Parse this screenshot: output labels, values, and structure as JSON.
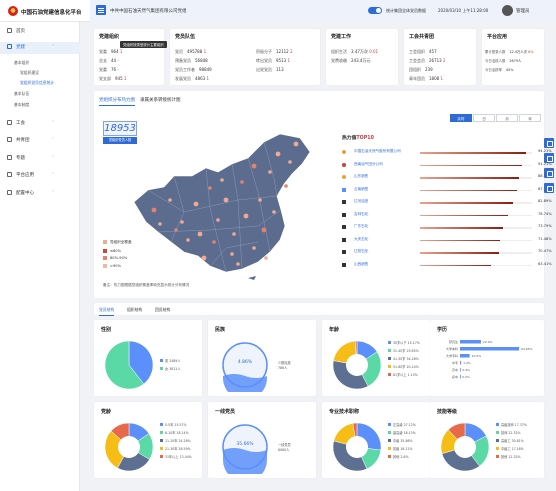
{
  "app": {
    "title": "中国石油党建信息化平台",
    "org": "中共中国石油天然气集团有限公司党组",
    "toggle_label": "统计集团全体党员数据",
    "datetime": "2020/03/10 上午11:28:00",
    "user": "管理员"
  },
  "sidebar": {
    "items": [
      {
        "label": "首页"
      },
      {
        "label": "党建"
      },
      {
        "label": "工会"
      },
      {
        "label": "共青团"
      },
      {
        "label": "专题"
      },
      {
        "label": "平台应用"
      },
      {
        "label": "配置中心"
      }
    ],
    "subitems": [
      {
        "label": "基本组织"
      },
      {
        "label": "党组织建设"
      },
      {
        "label": "党组织党员信息统计"
      },
      {
        "label": "基本队伍"
      },
      {
        "label": "基本制度"
      }
    ]
  },
  "stats": {
    "org": {
      "title": "党建组织",
      "tooltip": "党组织按类型统计主要组织",
      "rows": [
        {
          "k": "党委",
          "v": "964",
          "d": "1"
        },
        {
          "k": "总支",
          "v": "44",
          "d": "-"
        },
        {
          "k": "党委",
          "v": "76",
          "d": "-"
        },
        {
          "k": "党支部",
          "v": "945",
          "d": "1"
        }
      ]
    },
    "team": {
      "title": "党员队伍",
      "rows": [
        {
          "k": "党员",
          "v": "495788",
          "d": "1"
        },
        {
          "k": "预备党员",
          "v": "56848",
          "d": "-"
        },
        {
          "k": "党员工作者",
          "v": "98849",
          "d": "-"
        },
        {
          "k": "发展党员",
          "v": "4863",
          "d": "1"
        }
      ],
      "rows2": [
        {
          "k": "积极分子",
          "v": "12112",
          "d": "2"
        },
        {
          "k": "转出党员",
          "v": "9513",
          "d": "1"
        },
        {
          "k": "出党党员",
          "v": "113",
          "d": "-"
        }
      ]
    },
    "work": {
      "title": "党建工作",
      "rows": [
        {
          "k": "组织生活",
          "v": "3.47万次",
          "d": "0.01"
        },
        {
          "k": "党费收缴",
          "v": "243.4万元",
          "d": "-"
        }
      ]
    },
    "union": {
      "title": "工会共青团",
      "rows": [
        {
          "k": "工会组织",
          "v": "457",
          "d": "-"
        },
        {
          "k": "工会会员",
          "v": "26713",
          "d": "2"
        },
        {
          "k": "团组织",
          "v": "239",
          "d": "-"
        },
        {
          "k": "青年团员",
          "v": "1808",
          "d": "1"
        }
      ]
    },
    "platform": {
      "title": "平台应用",
      "rows": [
        {
          "k": "累计登录人数",
          "v": "12.4万人次",
          "d": "6%"
        },
        {
          "k": "今日活跃人数",
          "v": "2679人",
          "d": ""
        },
        {
          "k": "今日活跃率",
          "v": "45%",
          "d": ""
        }
      ]
    }
  },
  "maptabs": [
    {
      "label": "党组织分布热力图"
    },
    {
      "label": "隶属关系转接统计图"
    }
  ],
  "segments": [
    {
      "label": "实时"
    },
    {
      "label": "日"
    },
    {
      "label": "月"
    },
    {
      "label": "年"
    }
  ],
  "counter": {
    "value": "18953",
    "label": "党组织党员人数"
  },
  "map_legend": {
    "title": "党组织全覆盖",
    "items": [
      {
        "label": "≤80%"
      },
      {
        "label": "80%-90%"
      },
      {
        "label": ">90%"
      }
    ]
  },
  "map_note": "备注：热力图根据党组织覆盖率填充显示统计分布情况",
  "hot": {
    "title": "热力值",
    "title_em": "TOP10",
    "rows": [
      {
        "name": "中国石油天然气股份有限公司",
        "pct": "94.21%",
        "v": 94.21
      },
      {
        "name": "西南油气田分公司",
        "pct": "91.21%",
        "v": 91.21
      },
      {
        "name": "山东销售",
        "pct": "88.25%",
        "v": 88.25
      },
      {
        "name": "云南销售",
        "pct": "87.05%",
        "v": 87.05
      },
      {
        "name": "辽河油田",
        "pct": "82.89%",
        "v": 82.89
      },
      {
        "name": "吉林石化",
        "pct": "78.74%",
        "v": 78.74
      },
      {
        "name": "广东石化",
        "pct": "73.79%",
        "v": 73.79
      },
      {
        "name": "大庆石化",
        "pct": "71.48%",
        "v": 71.48
      },
      {
        "name": "辽阳石化",
        "pct": "70.47%",
        "v": 70.47
      },
      {
        "name": "山西销售",
        "pct": "63.41%",
        "v": 63.41
      }
    ]
  },
  "structtabs": [
    {
      "label": "党员结构"
    },
    {
      "label": "组织结构"
    },
    {
      "label": "团员结构"
    }
  ],
  "charts": {
    "gender": {
      "title": "性别",
      "legend": [
        {
          "label": "男",
          "v": "2489人"
        },
        {
          "label": "女",
          "v": "3811人"
        }
      ]
    },
    "ethnic": {
      "title": "民族",
      "center": "4.86%",
      "legend": [
        {
          "label": "少数民族",
          "v": "786人"
        }
      ]
    },
    "age": {
      "title": "年龄",
      "legend": [
        {
          "label": "30岁以下",
          "v": "15.17%"
        },
        {
          "label": "31-40岁",
          "v": "25.65%"
        },
        {
          "label": "41-50岁",
          "v": "34.28%"
        },
        {
          "label": "51-60岁",
          "v": "20.14%"
        },
        {
          "label": "61岁以上",
          "v": "1.15%"
        }
      ]
    },
    "education": {
      "title": "学历",
      "bars": [
        {
          "label": "研究生",
          "v": "22.9%"
        },
        {
          "label": "大学本科",
          "v": "64.65%"
        },
        {
          "label": "大学专科",
          "v": "10.5%"
        },
        {
          "label": "中专",
          "v": "1.2%"
        },
        {
          "label": "高中",
          "v": "0.4%"
        },
        {
          "label": "初中",
          "v": "0.2%"
        }
      ]
    },
    "partyage": {
      "title": "党龄",
      "legend": [
        {
          "label": "0-5年",
          "v": "15.57%"
        },
        {
          "label": "6-10年",
          "v": "18.14%"
        },
        {
          "label": "11-20年",
          "v": "24.26%"
        },
        {
          "label": "21-30年",
          "v": "28.59%"
        },
        {
          "label": "31年以上",
          "v": "13.44%"
        }
      ]
    },
    "frontline": {
      "title": "一线党员",
      "center": "35.66%",
      "legend": [
        {
          "label": "一线党员",
          "v": "6060人"
        }
      ]
    },
    "techtitle": {
      "title": "专业技术职称",
      "legend": [
        {
          "label": "正高级",
          "v": "27.12%"
        },
        {
          "label": "副高级",
          "v": "16.13%"
        },
        {
          "label": "中级",
          "v": "35.86%"
        },
        {
          "label": "初级",
          "v": "18.11%"
        },
        {
          "label": "其他",
          "v": "2.8%"
        }
      ]
    },
    "skill": {
      "title": "技能等级",
      "legend": [
        {
          "label": "高级技师",
          "v": "17.37%"
        },
        {
          "label": "技师",
          "v": "22.32%"
        },
        {
          "label": "高级工",
          "v": "30.81%"
        },
        {
          "label": "中级工",
          "v": "17.18%"
        },
        {
          "label": "其他",
          "v": "12.32%"
        }
      ]
    }
  },
  "colors": {
    "primary": "#2f6bd7",
    "pie": [
      "#5b8ff9",
      "#5ad8a6",
      "#5d7092",
      "#f6bd16",
      "#e8684a"
    ]
  }
}
